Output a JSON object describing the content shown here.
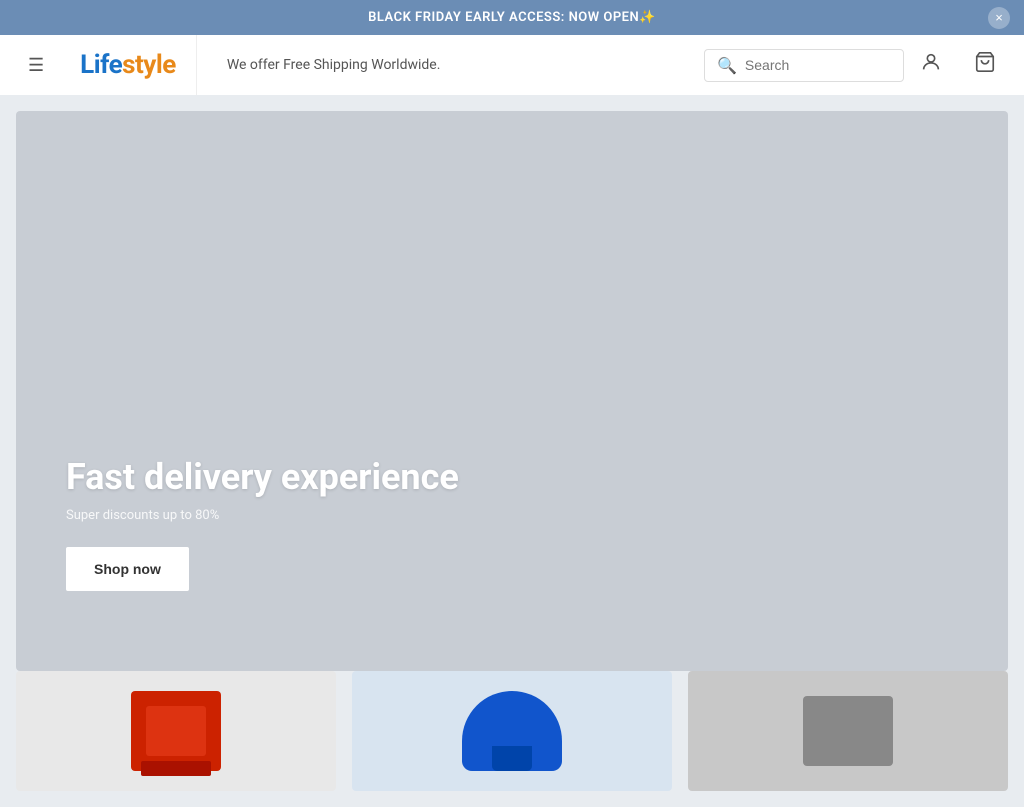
{
  "banner": {
    "text": "BLACK FRIDAY EARLY ACCESS: NOW OPEN✨",
    "close_label": "×"
  },
  "header": {
    "menu_icon": "☰",
    "logo_part1": "Life",
    "logo_part2": "style",
    "tagline": "We offer Free Shipping Worldwide.",
    "search_placeholder": "Search",
    "user_icon": "👤",
    "cart_icon": "🛒"
  },
  "hero": {
    "title": "Fast delivery experience",
    "subtitle": "Super discounts up to 80%",
    "cta_label": "Shop now"
  },
  "products": [
    {
      "id": "product-1",
      "color": "#e8e8e8"
    },
    {
      "id": "product-2",
      "color": "#d0dce8"
    },
    {
      "id": "product-3",
      "color": "#c4c4c4"
    }
  ]
}
